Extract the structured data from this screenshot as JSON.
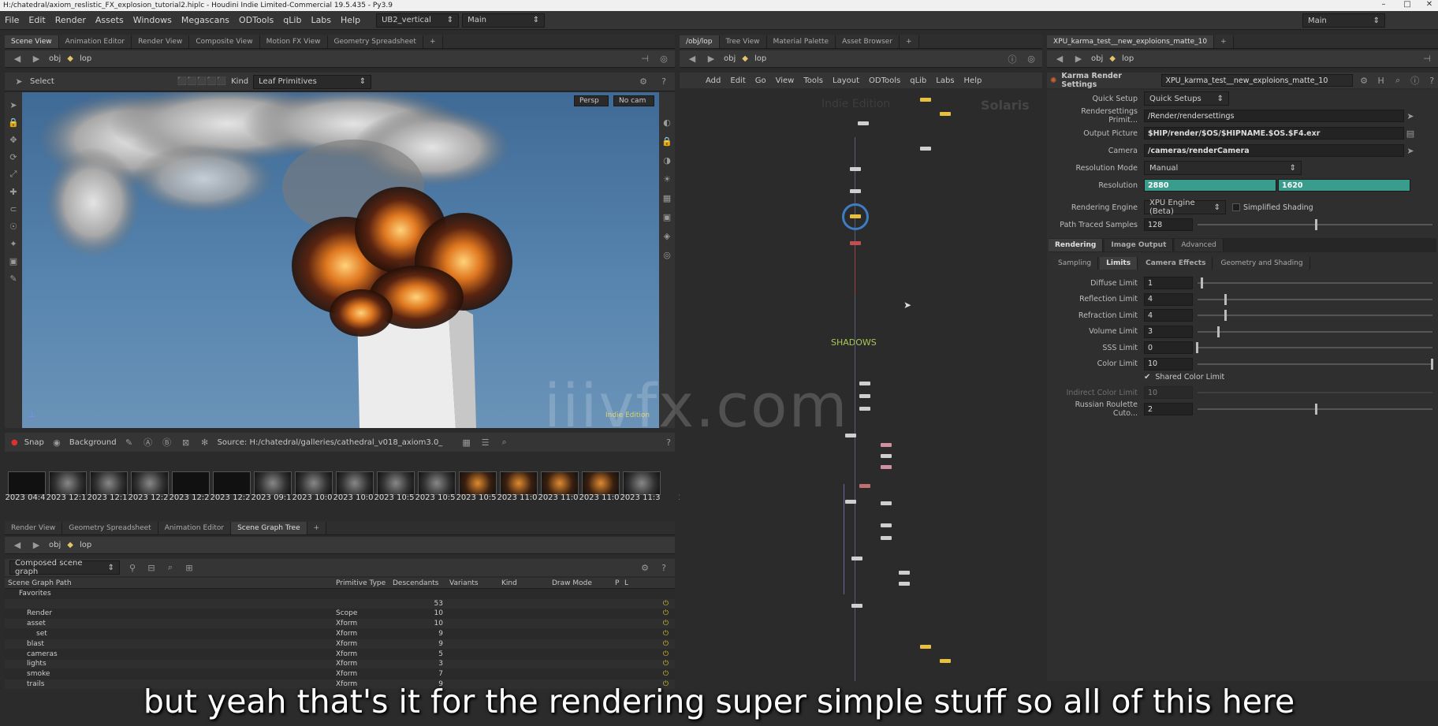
{
  "window": {
    "title": "H:/chatedral/axiom_reslistic_FX_explosion_tutorial2.hiplc - Houdini Indie Limited-Commercial 19.5.435 - Py3.9"
  },
  "menubar": {
    "items": [
      "File",
      "Edit",
      "Render",
      "Assets",
      "Windows",
      "Megascans",
      "ODTools",
      "qLib",
      "Labs",
      "Help"
    ],
    "desktop": "UB2_vertical",
    "context": "Main",
    "right_context": "Main"
  },
  "scene_tabs": [
    "Scene View",
    "Animation Editor",
    "Render View",
    "Composite View",
    "Motion FX View",
    "Geometry Spreadsheet"
  ],
  "scene_path": {
    "root": "obj",
    "node": "lop"
  },
  "select_bar": {
    "tool": "Select",
    "kind_label": "Kind",
    "kind_value": "Leaf Primitives"
  },
  "viewport": {
    "persp": "Persp",
    "cam": "No cam",
    "edition": "Indie Edition"
  },
  "gallery": {
    "snap": "Snap",
    "background": "Background",
    "source": "Source: H:/chatedral/galleries/cathedral_v018_axiom3.0_",
    "labels": [
      "2023 04:4",
      "2023 12:1",
      "2023 12:1",
      "2023 12:2",
      "2023 12:2",
      "2023 12:2",
      "2023 09:1",
      "2023 10:0",
      "2023 10:0",
      "2023 10:5",
      "2023 10:5",
      "2023 10:5",
      "2023 11:0",
      "2023 11:0",
      "2023 11:0",
      "2023 11:3",
      "2"
    ]
  },
  "lower_tabs": [
    "Render View",
    "Geometry Spreadsheet",
    "Animation Editor",
    "Scene Graph Tree"
  ],
  "lower_path": {
    "root": "obj",
    "node": "lop"
  },
  "scene_graph": {
    "mode": "Composed scene graph",
    "columns": [
      "Scene Graph Path",
      "Primitive Type",
      "Descendants",
      "Variants",
      "Kind",
      "Draw Mode",
      "P",
      "L"
    ],
    "favorites": "Favorites",
    "rows": [
      {
        "name": "",
        "type": "",
        "desc": "53"
      },
      {
        "name": "Render",
        "type": "Scope",
        "desc": "10"
      },
      {
        "name": "asset",
        "type": "Xform",
        "desc": "10"
      },
      {
        "name": "set",
        "type": "Xform",
        "desc": "9"
      },
      {
        "name": "blast",
        "type": "Xform",
        "desc": "9"
      },
      {
        "name": "cameras",
        "type": "Xform",
        "desc": "5"
      },
      {
        "name": "lights",
        "type": "Xform",
        "desc": "3"
      },
      {
        "name": "smoke",
        "type": "Xform",
        "desc": "7"
      },
      {
        "name": "trails",
        "type": "Xform",
        "desc": "9"
      }
    ]
  },
  "network_tabs": [
    "/obj/lop",
    "Tree View",
    "Material Palette",
    "Asset Browser"
  ],
  "network_path": {
    "root": "obj",
    "node": "lop"
  },
  "network_menu": [
    "Add",
    "Edit",
    "Go",
    "View",
    "Tools",
    "Layout",
    "ODTools",
    "qLib",
    "Labs",
    "Help"
  ],
  "network": {
    "edition": "Indie Edition",
    "context": "Solaris",
    "sticky": "SHADOWS"
  },
  "params_tabs": [
    "XPU_karma_test__new_exploions_matte_10"
  ],
  "params_path": {
    "root": "obj",
    "node": "lop"
  },
  "params_header": {
    "type": "Karma Render Settings",
    "name": "XPU_karma_test__new_exploions_matte_10"
  },
  "params": {
    "quick_setup_label": "Quick Setup",
    "quick_setup_value": "Quick Setups",
    "rendersettings_label": "Rendersettings Primit...",
    "rendersettings_value": "/Render/rendersettings",
    "output_label": "Output Picture",
    "output_value": "$HIP/render/$OS/$HIPNAME.$OS.$F4.exr",
    "camera_label": "Camera",
    "camera_value": "/cameras/renderCamera",
    "resmode_label": "Resolution Mode",
    "resmode_value": "Manual",
    "resolution_label": "Resolution",
    "res_x": "2880",
    "res_y": "1620",
    "engine_label": "Rendering Engine",
    "engine_value": "XPU Engine (Beta)",
    "simplified": "Simplified Shading",
    "pts_label": "Path Traced Samples",
    "pts_value": "128",
    "main_tabs": [
      "Rendering",
      "Image Output",
      "Advanced"
    ],
    "sub_tabs": [
      "Sampling",
      "Limits",
      "Camera Effects",
      "Geometry and Shading"
    ],
    "limits": [
      {
        "label": "Diffuse Limit",
        "value": "1",
        "pos": 0.02
      },
      {
        "label": "Reflection Limit",
        "value": "4",
        "pos": 0.12
      },
      {
        "label": "Refraction Limit",
        "value": "4",
        "pos": 0.12
      },
      {
        "label": "Volume Limit",
        "value": "3",
        "pos": 0.09
      },
      {
        "label": "SSS Limit",
        "value": "0",
        "pos": 0.0
      },
      {
        "label": "Color Limit",
        "value": "10",
        "pos": 1.0
      }
    ],
    "shared_color": "Shared Color Limit",
    "indirect_label": "Indirect Color Limit",
    "indirect_value": "10",
    "rr_label": "Russian Roulette Cuto...",
    "rr_value": "2"
  },
  "watermark": "iiivfx.com",
  "subtitle": "but yeah that's it for the rendering super simple stuff so all of this here"
}
